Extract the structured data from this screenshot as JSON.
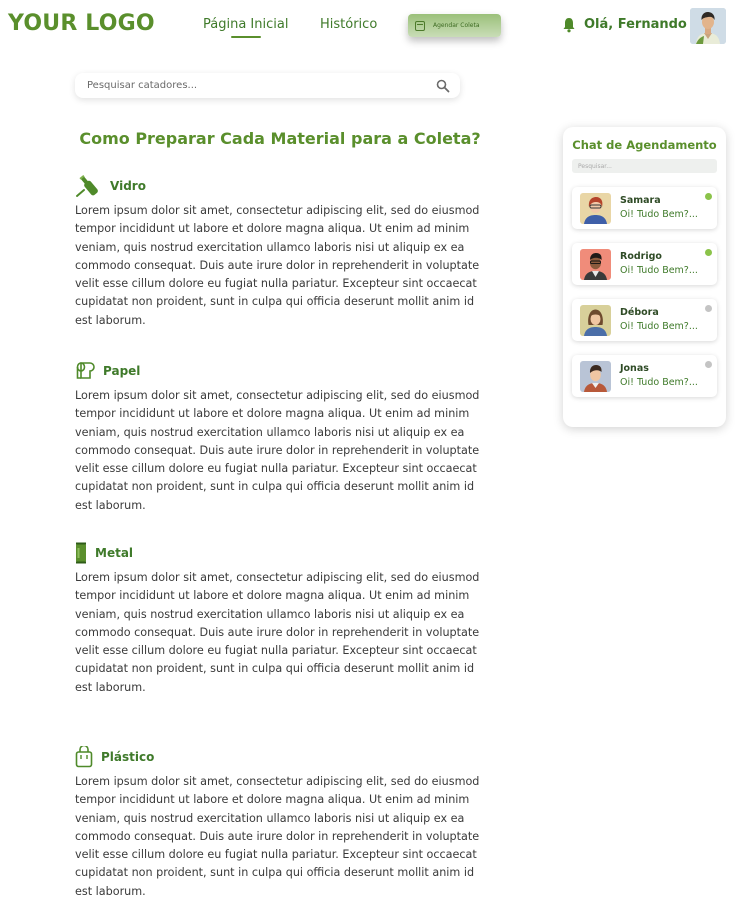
{
  "header": {
    "logo": "YOUR LOGO",
    "nav": {
      "home": "Página Inicial",
      "history": "Histórico"
    },
    "schedule_button": "Agendar Coleta",
    "greeting": "Olá, Fernando",
    "icons": {
      "bell": "bell-icon",
      "calendar": "calendar-icon"
    }
  },
  "search": {
    "placeholder": "Pesquisar catadores..."
  },
  "page_title": "Como Preparar Cada Material para a Coleta?",
  "sections": [
    {
      "title": "Vidro",
      "icon": "glass-bottle-icon",
      "text": "Lorem ipsum dolor sit amet, consectetur adipiscing elit, sed do eiusmod tempor incididunt ut labore et dolore magna aliqua. Ut enim ad minim veniam, quis nostrud exercitation ullamco laboris nisi ut aliquip ex ea commodo consequat. Duis aute irure dolor in reprehenderit in voluptate velit esse cillum dolore eu fugiat nulla pariatur. Excepteur sint occaecat cupidatat non proident, sunt in culpa qui officia deserunt mollit anim id est laborum."
    },
    {
      "title": "Papel",
      "icon": "paper-roll-icon",
      "text": "Lorem ipsum dolor sit amet, consectetur adipiscing elit, sed do eiusmod tempor incididunt ut labore et dolore magna aliqua. Ut enim ad minim veniam, quis nostrud exercitation ullamco laboris nisi ut aliquip ex ea commodo consequat. Duis aute irure dolor in reprehenderit in voluptate velit esse cillum dolore eu fugiat nulla pariatur. Excepteur sint occaecat cupidatat non proident, sunt in culpa qui officia deserunt mollit anim id est laborum."
    },
    {
      "title": "Metal",
      "icon": "metal-can-icon",
      "text": "Lorem ipsum dolor sit amet, consectetur adipiscing elit, sed do eiusmod tempor incididunt ut labore et dolore magna aliqua. Ut enim ad minim veniam, quis nostrud exercitation ullamco laboris nisi ut aliquip ex ea commodo consequat. Duis aute irure dolor in reprehenderit in voluptate velit esse cillum dolore eu fugiat nulla pariatur. Excepteur sint occaecat cupidatat non proident, sunt in culpa qui officia deserunt mollit anim id est laborum."
    },
    {
      "title": "Plástico",
      "icon": "plastic-bag-icon",
      "text": "Lorem ipsum dolor sit amet, consectetur adipiscing elit, sed do eiusmod tempor incididunt ut labore et dolore magna aliqua. Ut enim ad minim veniam, quis nostrud exercitation ullamco laboris nisi ut aliquip ex ea commodo consequat. Duis aute irure dolor in reprehenderit in voluptate velit esse cillum dolore eu fugiat nulla pariatur. Excepteur sint occaecat cupidatat non proident, sunt in culpa qui officia deserunt mollit anim id est laborum."
    }
  ],
  "chat": {
    "title": "Chat de Agendamento",
    "search_placeholder": "Pesquisar...",
    "contacts": [
      {
        "name": "Samara",
        "message": "Oi! Tudo Bem?...",
        "online": true
      },
      {
        "name": "Rodrigo",
        "message": "Oi! Tudo Bem?...",
        "online": true
      },
      {
        "name": "Débora",
        "message": "Oi! Tudo Bem?...",
        "online": false
      },
      {
        "name": "Jonas",
        "message": "Oi! Tudo Bem?...",
        "online": false
      }
    ]
  },
  "colors": {
    "brand": "#5a8f2c",
    "online": "#8bc34a",
    "offline": "#c4c4c4"
  }
}
